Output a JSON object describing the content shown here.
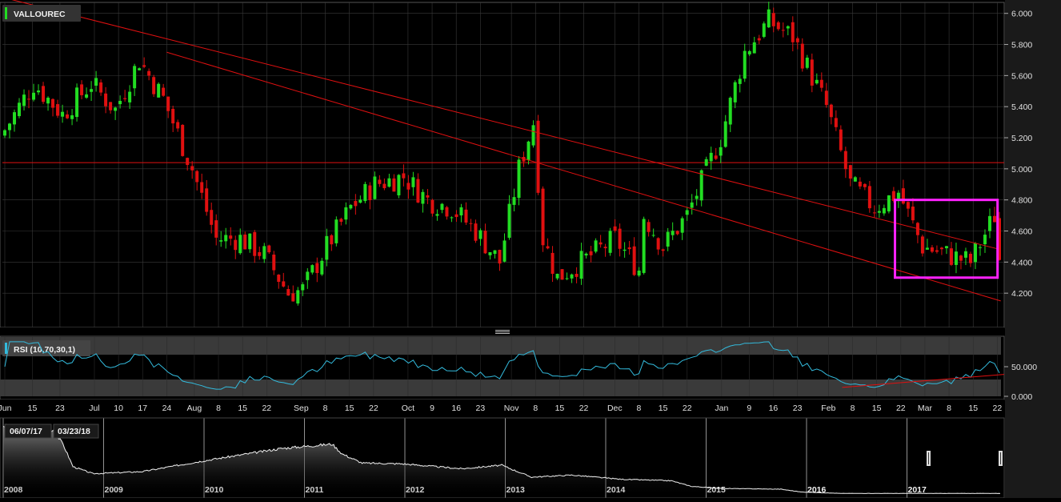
{
  "header": {
    "symbol": "VALLOUREC"
  },
  "indicator": {
    "label": "RSI (10,70,30,1)"
  },
  "navigator": {
    "range_start": "06/07/17",
    "range_end": "03/23/18",
    "years": [
      "2008",
      "2009",
      "2010",
      "2011",
      "2012",
      "2013",
      "2014",
      "2015",
      "2016",
      "2017"
    ]
  },
  "colors": {
    "up": "#22dd22",
    "down": "#e01010",
    "trendline": "#e01010",
    "rsi": "#33bbdd",
    "highlight_box": "#ff22ff",
    "grid": "#3a3a3a"
  },
  "chart_data": [
    {
      "type": "candlestick",
      "series_name": "VALLOUREC",
      "ylim": [
        4.0,
        6.05
      ],
      "y_ticks": [
        "6.000",
        "5.800",
        "5.600",
        "5.400",
        "5.200",
        "5.000",
        "4.800",
        "4.600",
        "4.400",
        "4.200"
      ],
      "x_tick_labels": [
        "Jun",
        "15",
        "23",
        "Jul",
        "10",
        "17",
        "24",
        "Aug",
        "8",
        "15",
        "22",
        "Sep",
        "8",
        "15",
        "22",
        "Oct",
        "9",
        "16",
        "23",
        "Nov",
        "8",
        "15",
        "22",
        "Dec",
        "8",
        "15",
        "22",
        "Jan",
        "9",
        "16",
        "23",
        "Feb",
        "8",
        "15",
        "22",
        "Mar",
        "8",
        "15",
        "22"
      ],
      "horizontal_level": 5.04,
      "close_anchors": [
        [
          "06/07/17",
          5.25
        ],
        [
          "06/15/17",
          5.55
        ],
        [
          "06/23/17",
          5.35
        ],
        [
          "07/03/17",
          5.55
        ],
        [
          "07/10/17",
          5.38
        ],
        [
          "07/17/17",
          5.7
        ],
        [
          "07/24/17",
          5.45
        ],
        [
          "08/01/17",
          5.0
        ],
        [
          "08/08/17",
          4.55
        ],
        [
          "08/15/17",
          4.55
        ],
        [
          "08/22/17",
          4.45
        ],
        [
          "08/29/17",
          4.2
        ],
        [
          "09/01/17",
          4.22
        ],
        [
          "09/08/17",
          4.5
        ],
        [
          "09/15/17",
          4.75
        ],
        [
          "09/22/17",
          4.9
        ],
        [
          "10/02/17",
          4.95
        ],
        [
          "10/09/17",
          4.8
        ],
        [
          "10/16/17",
          4.75
        ],
        [
          "10/23/17",
          4.6
        ],
        [
          "10/30/17",
          4.4
        ],
        [
          "11/03/17",
          5.0
        ],
        [
          "11/08/17",
          5.3
        ],
        [
          "11/10/17",
          4.55
        ],
        [
          "11/15/17",
          4.3
        ],
        [
          "11/22/17",
          4.4
        ],
        [
          "12/01/17",
          4.55
        ],
        [
          "12/08/17",
          4.35
        ],
        [
          "12/11/17",
          4.7
        ],
        [
          "12/15/17",
          4.5
        ],
        [
          "12/22/17",
          4.7
        ],
        [
          "01/02/18",
          5.2
        ],
        [
          "01/09/18",
          5.75
        ],
        [
          "01/16/18",
          5.95
        ],
        [
          "01/23/18",
          5.85
        ],
        [
          "02/01/18",
          5.4
        ],
        [
          "02/08/18",
          4.9
        ],
        [
          "02/15/18",
          4.75
        ],
        [
          "02/22/18",
          4.85
        ],
        [
          "03/01/18",
          4.5
        ],
        [
          "03/08/18",
          4.45
        ],
        [
          "03/15/18",
          4.4
        ],
        [
          "03/22/18",
          4.7
        ],
        [
          "03/23/18",
          4.42
        ]
      ],
      "trendlines": [
        {
          "from": [
            "05/29/17",
            6.15
          ],
          "to": [
            "03/23/18",
            4.48
          ]
        },
        {
          "from": [
            "07/24/17",
            5.75
          ],
          "to": [
            "03/23/18",
            4.15
          ]
        }
      ],
      "highlight": {
        "from": "02/21/18",
        "to": "03/23/18",
        "low": 4.3,
        "high": 4.8
      }
    },
    {
      "type": "line",
      "series_name": "RSI (10,70,30,1)",
      "ylim": [
        0,
        100
      ],
      "y_ticks": [
        "50.000",
        "0.000"
      ],
      "overbought": 70,
      "oversold": 30,
      "trendline": {
        "from": [
          "02/05/18",
          15
        ],
        "to": [
          "03/23/18",
          37
        ]
      }
    }
  ]
}
